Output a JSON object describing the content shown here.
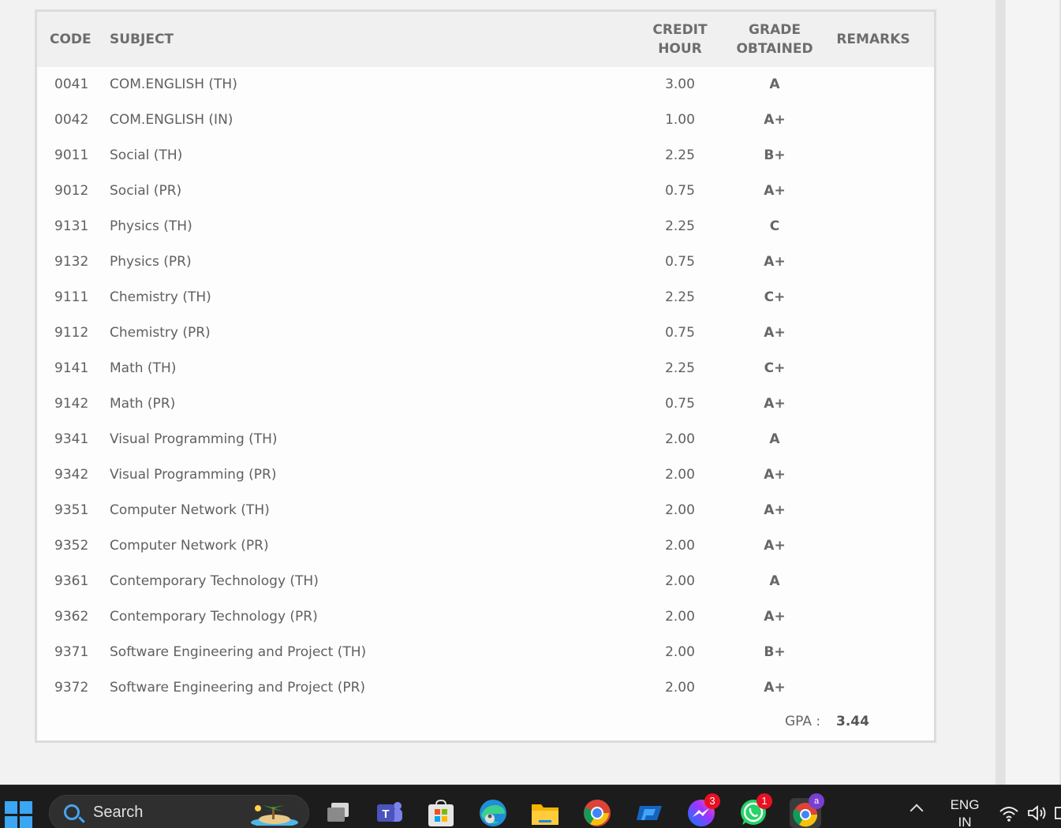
{
  "table": {
    "headers": {
      "code": "CODE",
      "subject": "SUBJECT",
      "credit_line1": "CREDIT",
      "credit_line2": "HOUR",
      "grade_line1": "GRADE",
      "grade_line2": "OBTAINED",
      "remarks": "REMARKS"
    },
    "rows": [
      {
        "code": "0041",
        "subject": "COM.ENGLISH (TH)",
        "credit": "3.00",
        "grade": "A"
      },
      {
        "code": "0042",
        "subject": "COM.ENGLISH (IN)",
        "credit": "1.00",
        "grade": "A+"
      },
      {
        "code": "9011",
        "subject": "Social (TH)",
        "credit": "2.25",
        "grade": "B+"
      },
      {
        "code": "9012",
        "subject": "Social (PR)",
        "credit": "0.75",
        "grade": "A+"
      },
      {
        "code": "9131",
        "subject": "Physics (TH)",
        "credit": "2.25",
        "grade": "C"
      },
      {
        "code": "9132",
        "subject": "Physics (PR)",
        "credit": "0.75",
        "grade": "A+"
      },
      {
        "code": "9111",
        "subject": "Chemistry (TH)",
        "credit": "2.25",
        "grade": "C+"
      },
      {
        "code": "9112",
        "subject": "Chemistry (PR)",
        "credit": "0.75",
        "grade": "A+"
      },
      {
        "code": "9141",
        "subject": "Math (TH)",
        "credit": "2.25",
        "grade": "C+"
      },
      {
        "code": "9142",
        "subject": "Math (PR)",
        "credit": "0.75",
        "grade": "A+"
      },
      {
        "code": "9341",
        "subject": "Visual Programming (TH)",
        "credit": "2.00",
        "grade": "A"
      },
      {
        "code": "9342",
        "subject": "Visual Programming (PR)",
        "credit": "2.00",
        "grade": "A+"
      },
      {
        "code": "9351",
        "subject": "Computer Network (TH)",
        "credit": "2.00",
        "grade": "A+"
      },
      {
        "code": "9352",
        "subject": "Computer Network (PR)",
        "credit": "2.00",
        "grade": "A+"
      },
      {
        "code": "9361",
        "subject": "Contemporary Technology (TH)",
        "credit": "2.00",
        "grade": "A"
      },
      {
        "code": "9362",
        "subject": "Contemporary Technology (PR)",
        "credit": "2.00",
        "grade": "A+"
      },
      {
        "code": "9371",
        "subject": "Software Engineering and Project (TH)",
        "credit": "2.00",
        "grade": "B+"
      },
      {
        "code": "9372",
        "subject": "Software Engineering and Project (PR)",
        "credit": "2.00",
        "grade": "A+"
      }
    ],
    "gpa_label": "GPA :",
    "gpa_value": "3.44"
  },
  "taskbar": {
    "search_label": "Search",
    "messenger_badge": "3",
    "whatsapp_badge": "1",
    "chrome_profile_badge": "a",
    "lang_line1": "ENG",
    "lang_line2": "IN",
    "apps": [
      "start-icon",
      "task-view-icon",
      "teams-icon",
      "microsoft-store-icon",
      "edge-icon",
      "file-explorer-icon",
      "chrome-icon",
      "vpn-app-icon",
      "messenger-icon",
      "whatsapp-icon",
      "chrome-profile-icon"
    ]
  }
}
